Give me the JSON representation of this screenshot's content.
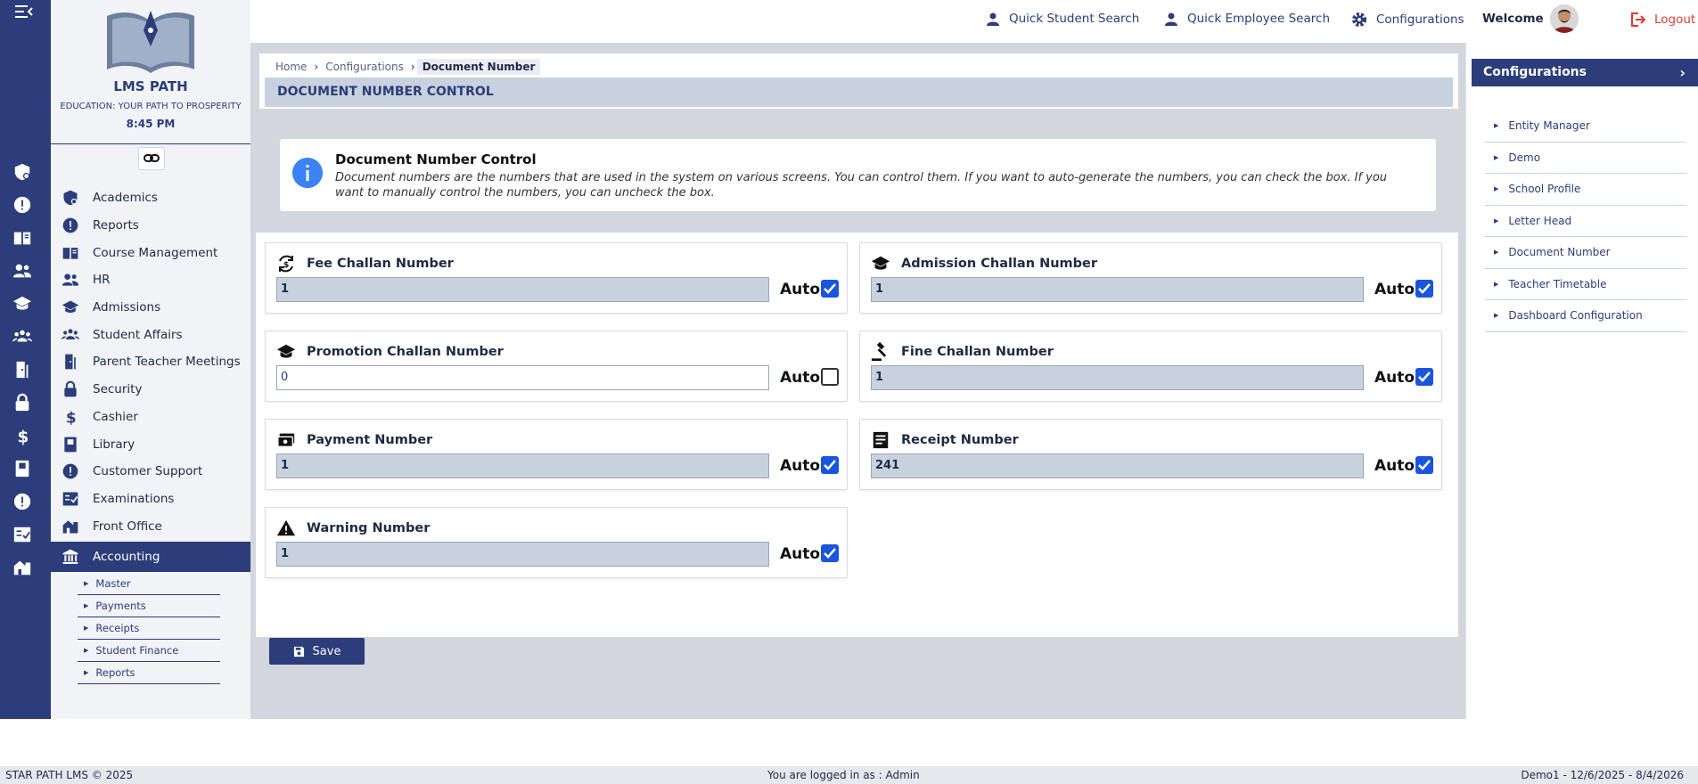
{
  "brand": {
    "name": "LMS PATH",
    "tagline": "EDUCATION: YOUR PATH TO PROSPERITY",
    "time": "8:45 PM"
  },
  "sidebar": {
    "items": [
      {
        "label": "Academics",
        "icon": "academics-icon"
      },
      {
        "label": "Reports",
        "icon": "alert-icon"
      },
      {
        "label": "Course Management",
        "icon": "book-icon"
      },
      {
        "label": "HR",
        "icon": "people-icon"
      },
      {
        "label": "Admissions",
        "icon": "graduation-cap-icon"
      },
      {
        "label": "Student Affairs",
        "icon": "group-icon"
      },
      {
        "label": "Parent Teacher Meetings",
        "icon": "door-icon"
      },
      {
        "label": "Security",
        "icon": "lock-icon"
      },
      {
        "label": "Cashier",
        "icon": "dollar-icon"
      },
      {
        "label": "Library",
        "icon": "library-icon"
      },
      {
        "label": "Customer Support",
        "icon": "alert-icon"
      },
      {
        "label": "Examinations",
        "icon": "checklist-icon"
      },
      {
        "label": "Front Office",
        "icon": "building-icon"
      },
      {
        "label": "Accounting",
        "icon": "bank-icon"
      }
    ],
    "submenu": [
      "Master",
      "Payments",
      "Receipts",
      "Student Finance",
      "Reports"
    ]
  },
  "topbar": {
    "quick_student": "Quick Student Search",
    "quick_employee": "Quick Employee Search",
    "configurations": "Configurations",
    "welcome": "Welcome",
    "logout": "Logout"
  },
  "breadcrumb": {
    "home": "Home",
    "section": "Configurations",
    "current": "Document Number"
  },
  "page_title": "DOCUMENT NUMBER CONTROL",
  "info": {
    "title": "Document Number Control",
    "text": "Document numbers are the numbers that are used in the system on various screens. You can control them. If you want to auto-generate the numbers, you can check the box. If you want to manually control the numbers, you can uncheck the box."
  },
  "fields": {
    "fee_challan": {
      "label": "Fee Challan Number",
      "value": "1",
      "auto_label": "Auto",
      "auto": true
    },
    "admission_challan": {
      "label": "Admission Challan Number",
      "value": "1",
      "auto_label": "Auto",
      "auto": true
    },
    "promotion_challan": {
      "label": "Promotion Challan Number",
      "value": "0",
      "auto_label": "Auto",
      "auto": false
    },
    "fine_challan": {
      "label": "Fine Challan Number",
      "value": "1",
      "auto_label": "Auto",
      "auto": true
    },
    "payment": {
      "label": "Payment Number",
      "value": "1",
      "auto_label": "Auto",
      "auto": true
    },
    "receipt": {
      "label": "Receipt Number",
      "value": "241",
      "auto_label": "Auto",
      "auto": true
    },
    "warning": {
      "label": "Warning Number",
      "value": "1",
      "auto_label": "Auto",
      "auto": true
    }
  },
  "save_label": "Save",
  "right_panel": {
    "title": "Configurations",
    "items": [
      "Entity Manager",
      "Demo",
      "School Profile",
      "Letter Head",
      "Document Number",
      "Teacher Timetable",
      "Dashboard Configuration"
    ]
  },
  "footer": {
    "left": "STAR PATH LMS © 2025",
    "center": "You are logged in as : Admin",
    "right": "Demo1 -  12/6/2025 - 8/4/2026"
  },
  "colors": {
    "primary": "#2b3d7a",
    "checkbox": "#1a56db",
    "logout": "#e53935",
    "info": "#3b82f6"
  }
}
